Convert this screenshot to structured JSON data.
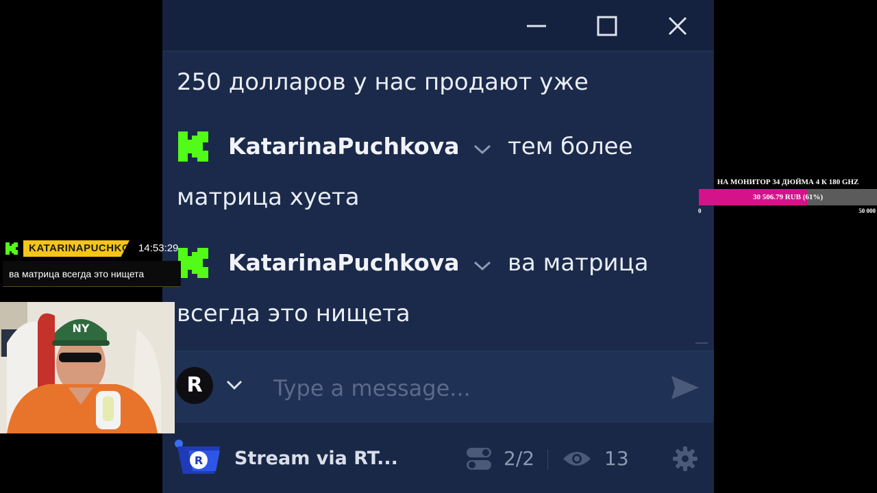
{
  "window": {
    "controls": [
      "minimize",
      "maximize",
      "close"
    ]
  },
  "chat": {
    "messages": [
      {
        "text": "250 долларов у нас продают уже"
      },
      {
        "username": "KatarinaPuchkova",
        "text_line1": "тем более",
        "text_line2": "матрица хуета"
      },
      {
        "username": "KatarinaPuchkova",
        "text_line1": "ва матрица",
        "text_line2": "всегда это нищета"
      }
    ],
    "input": {
      "avatar_letter": "R",
      "placeholder": "Type a message..."
    }
  },
  "footer": {
    "stream_name": "Stream via RT...",
    "platforms": "2/2",
    "viewers": "13"
  },
  "overlay": {
    "username": "KATARINAPUCHKOVA",
    "time": "14:53:29",
    "message": "ва матрица всегда это нищета"
  },
  "goal": {
    "title": "НА МОНИТОР 34 ДЮЙМА 4 К 180 GHZ",
    "amount_text": "30 506.79 RUB (61%)",
    "progress": 0.61,
    "min": "0",
    "max": "50 000"
  },
  "colors": {
    "window_bg": "#1b2a4a",
    "kick_green": "#53fc18",
    "goal_fill": "#d4138a",
    "overlay_name_bg": "#f5c518"
  }
}
